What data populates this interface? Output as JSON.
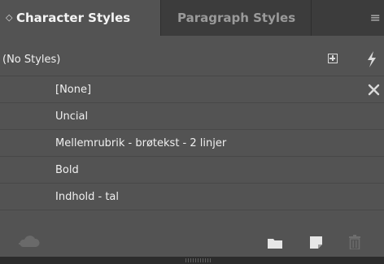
{
  "tabs": [
    {
      "label": "Character Styles",
      "active": true
    },
    {
      "label": "Paragraph Styles",
      "active": false
    }
  ],
  "icons": {
    "tab_chevron": "◇",
    "panel_menu": "≡"
  },
  "group": {
    "label": "(No Styles)"
  },
  "styles": [
    {
      "name": "[None]"
    },
    {
      "name": "Uncial"
    },
    {
      "name": "Mellemrubrik - brøtekst - 2 linjer"
    },
    {
      "name": "Bold"
    },
    {
      "name": "Indhold - tal"
    }
  ],
  "colors": {
    "panel_bg": "#535353",
    "tabbar_bg": "#3c3c3c",
    "text": "#f0f0f0",
    "inactive_tab_text": "#9a9a9a"
  }
}
